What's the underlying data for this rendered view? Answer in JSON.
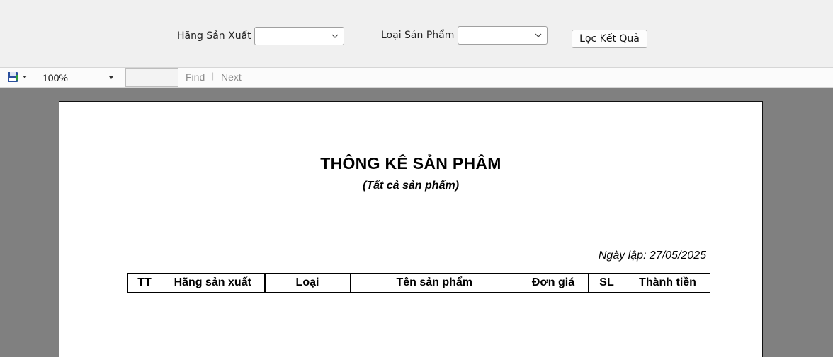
{
  "filters": {
    "manufacturer_label": "Hãng Sản Xuất",
    "manufacturer_value": "",
    "category_label": "Loại Sản Phẩm",
    "category_value": "",
    "filter_button_label": "Lọc Kết Quả"
  },
  "toolbar": {
    "save_icon": "save-floppy-icon",
    "zoom_value": "100%",
    "find_value": "",
    "find_label": "Find",
    "separator": "|",
    "next_label": "Next"
  },
  "report": {
    "title": "THÔNG KÊ SẢN PHÂM",
    "subtitle": "(Tất cả sản phẩm)",
    "date_line": "Ngày lập: 27/05/2025",
    "columns": [
      "TT",
      "Hãng sản xuất",
      "Loại",
      "Tên sản phẩm",
      "Đơn giá",
      "SL",
      "Thành tiền"
    ]
  },
  "colors": {
    "window_bg": "#f0f0f0",
    "viewport_bg": "#808080",
    "page_bg": "#ffffff",
    "link_disabled": "#8a8a8a"
  }
}
